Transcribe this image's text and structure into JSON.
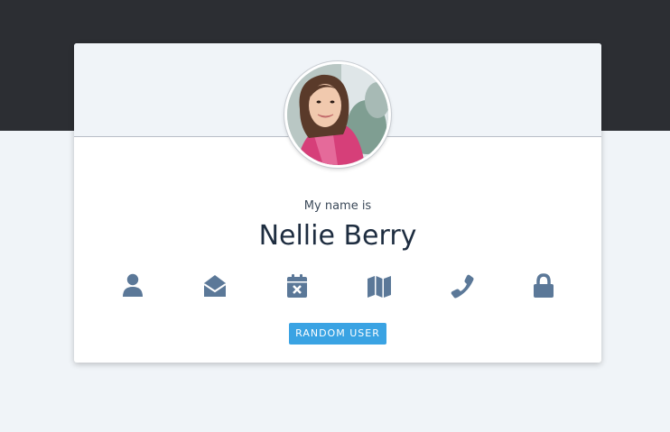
{
  "profile": {
    "label": "My name is",
    "name": "Nellie Berry"
  },
  "icons": [
    {
      "name": "user-icon"
    },
    {
      "name": "email-icon"
    },
    {
      "name": "calendar-icon"
    },
    {
      "name": "map-icon"
    },
    {
      "name": "phone-icon"
    },
    {
      "name": "lock-icon"
    }
  ],
  "button": {
    "label": "RANDOM USER"
  },
  "colors": {
    "top_band": "#2c2e33",
    "page_background": "#f0f4f8",
    "icon": "#5b7898",
    "button": "#3aa3e3",
    "name_text": "#1e2d40"
  }
}
